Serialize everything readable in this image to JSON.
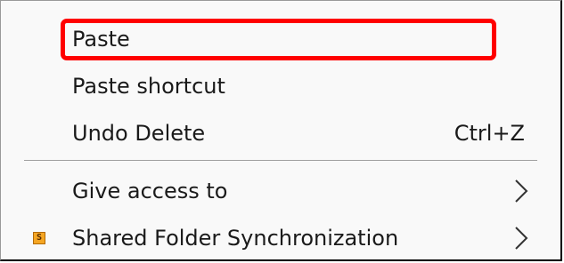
{
  "menu": {
    "items": [
      {
        "label": "Paste"
      },
      {
        "label": "Paste shortcut"
      },
      {
        "label": "Undo Delete",
        "shortcut": "Ctrl+Z"
      },
      {
        "label": "Give access to",
        "submenu_icon": "chevron-right-icon"
      },
      {
        "label": "Shared Folder Synchronization",
        "icon": "shared-folder-sync-icon",
        "icon_text": "S",
        "submenu_icon": "chevron-right-icon"
      }
    ]
  },
  "highlight_color": "#ff0000"
}
